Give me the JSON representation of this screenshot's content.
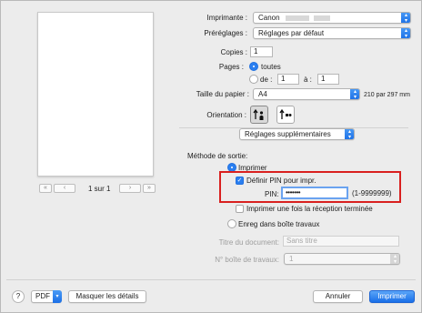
{
  "preview": {
    "page_indicator": "1 sur 1",
    "first_label": "«",
    "prev_label": "‹",
    "next_label": "›",
    "last_label": "»"
  },
  "printer": {
    "label": "Imprimante :",
    "value": "Canon"
  },
  "presets": {
    "label": "Préréglages :",
    "value": "Réglages par défaut"
  },
  "copies": {
    "label": "Copies :",
    "value": "1"
  },
  "pages": {
    "label": "Pages :",
    "all_label": "toutes",
    "from_label": "de :",
    "from_value": "1",
    "to_label": "à :",
    "to_value": "1"
  },
  "paper_size": {
    "label": "Taille du papier :",
    "value": "A4",
    "dimensions": "210 par 297 mm"
  },
  "orientation": {
    "label": "Orientation :"
  },
  "panel": {
    "value": "Réglages supplémentaires"
  },
  "output": {
    "label": "Méthode de sortie:",
    "print_label": "Imprimer",
    "set_pin_label": "Définir PIN pour impr.",
    "pin_label": "PIN:",
    "pin_value": "•••••••",
    "pin_range": "(1-9999999)",
    "print_once_label": "Imprimer une fois la réception terminée",
    "save_label": "Enreg dans boîte travaux",
    "doc_title_label": "Titre du document:",
    "doc_title_value": "Sans titre",
    "box_number_label": "N° boîte de travaux:",
    "box_number_value": "1"
  },
  "footer": {
    "help_label": "?",
    "pdf_label": "PDF",
    "hide_details_label": "Masquer les détails",
    "cancel_label": "Annuler",
    "print_label": "Imprimer"
  },
  "colors": {
    "accent": "#2a7ff0",
    "highlight": "#d9201f"
  }
}
